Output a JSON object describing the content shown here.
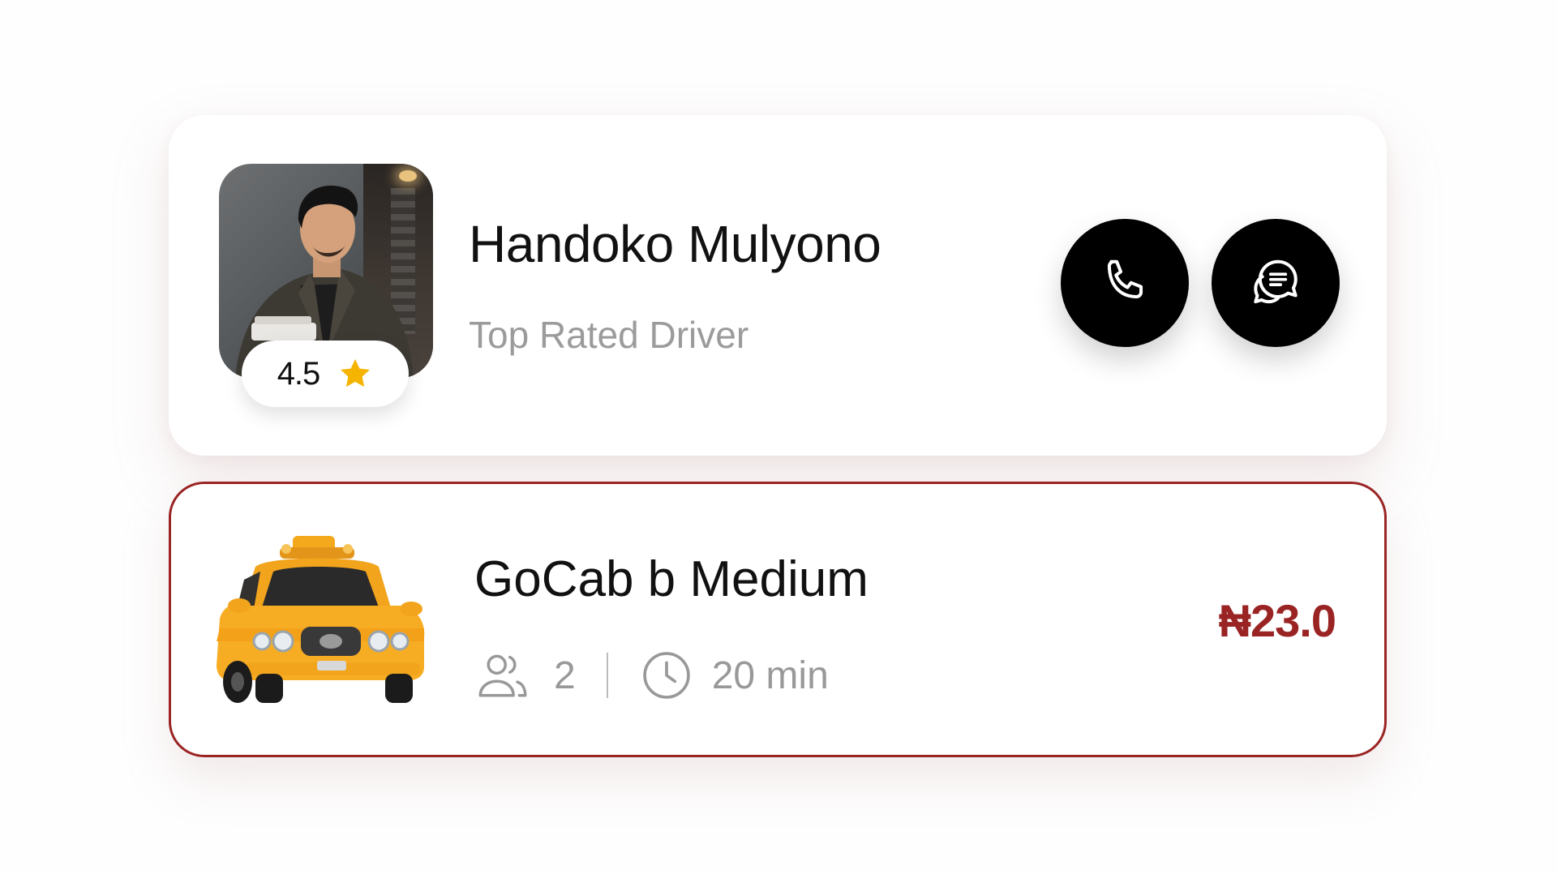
{
  "driver": {
    "name": "Handoko Mulyono",
    "subtitle": "Top Rated Driver",
    "rating": "4.5",
    "star_color": "#f4b400",
    "avatar_icon": "driver-photo",
    "call_icon": "phone-icon",
    "chat_icon": "chat-bubble-icon"
  },
  "ride": {
    "name": "GoCab b Medium",
    "passengers": "2",
    "duration": "20 min",
    "price": "₦23.0",
    "vehicle_icon": "taxi-icon",
    "passengers_icon": "people-icon",
    "duration_icon": "clock-icon"
  },
  "colors": {
    "accent": "#9a2424",
    "button_bg": "#000000",
    "muted_text": "#9b9b9b"
  }
}
